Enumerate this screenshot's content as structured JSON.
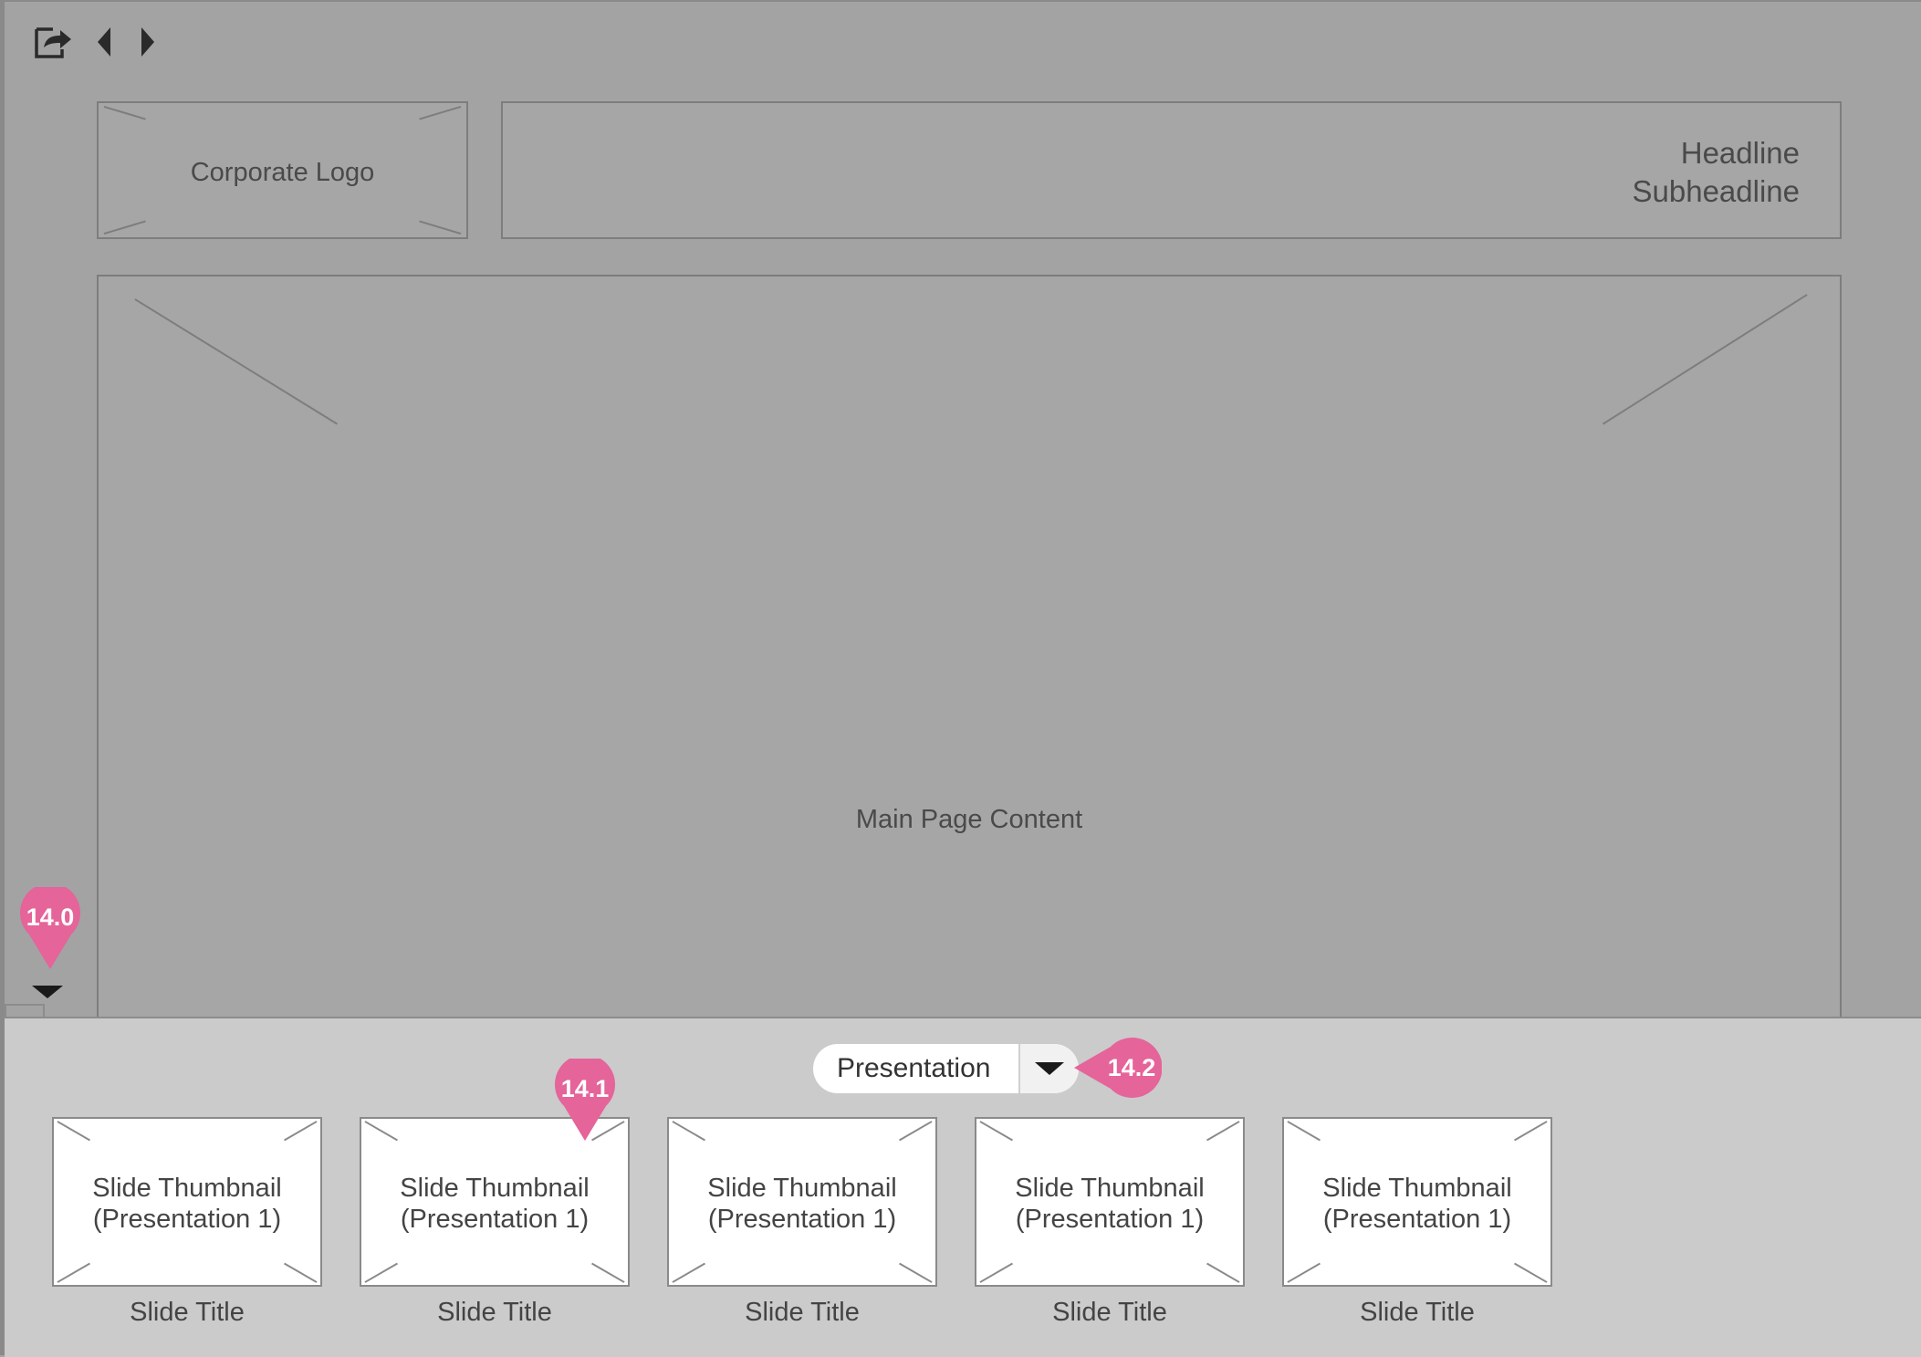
{
  "toolbar": {
    "icons": [
      "export-icon",
      "previous-icon",
      "next-icon"
    ]
  },
  "header": {
    "logo_label": "Corporate Logo",
    "headline": "Headline",
    "subheadline": "Subheadline"
  },
  "main": {
    "content_label": "Main Page Content"
  },
  "drawer": {
    "select_value": "Presentation",
    "thumbnails": [
      {
        "line1": "Slide Thumbnail",
        "line2": "(Presentation 1)",
        "title": "Slide Title"
      },
      {
        "line1": "Slide Thumbnail",
        "line2": "(Presentation 1)",
        "title": "Slide Title"
      },
      {
        "line1": "Slide Thumbnail",
        "line2": "(Presentation 1)",
        "title": "Slide Title"
      },
      {
        "line1": "Slide Thumbnail",
        "line2": "(Presentation 1)",
        "title": "Slide Title"
      },
      {
        "line1": "Slide Thumbnail",
        "line2": "(Presentation 1)",
        "title": "Slide Title"
      }
    ]
  },
  "annotations": {
    "m0": "14.0",
    "m1": "14.1",
    "m2": "14.2"
  },
  "colors": {
    "background": "#a3a3a3",
    "drawer": "#cbcbcb",
    "annotation": "#e5649a"
  }
}
